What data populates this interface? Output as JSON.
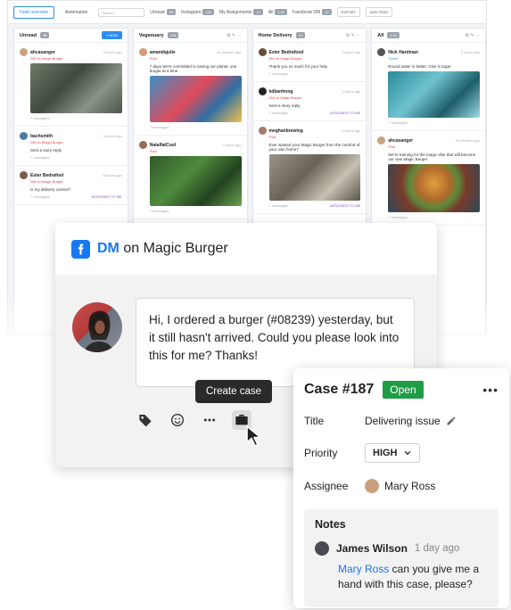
{
  "dashboard": {
    "tabs": [
      "Field overview",
      "Automation"
    ],
    "search_placeholder": "Search...",
    "filters": [
      {
        "label": "Unread",
        "count": "38"
      },
      {
        "label": "Instagram",
        "count": "125"
      },
      {
        "label": "My Assignments",
        "count": "12"
      },
      {
        "label": "All",
        "count": "1.2k"
      },
      {
        "label": "Facebook DM",
        "count": "24"
      }
    ],
    "buttons": {
      "export": "EXPORT",
      "add_feed": "ADD FEED"
    },
    "columns": [
      {
        "title": "Unread",
        "count": "38",
        "new_label": "+ NEW"
      },
      {
        "title": "Veganuary",
        "count": "125"
      },
      {
        "title": "Home Delivery",
        "count": "14"
      },
      {
        "title": "All",
        "count": "1.2k"
      }
    ],
    "cards": [
      {
        "name": "ahcasanger",
        "sub": "DM on Magic Burger",
        "time": "3 hours ago",
        "msg": "",
        "meta": "7 messages"
      },
      {
        "name": "bachsmith",
        "sub": "DM on Magic Burger",
        "time": "5 hours ago",
        "msg": "Sent a story reply",
        "meta": "7 messages"
      },
      {
        "name": "Ester Bedrafool",
        "sub": "DM on Magic Burger",
        "time": "6 hours ago",
        "msg": "Is my delivery correct?",
        "meta": "7 messages",
        "assigned": "ASSIGNED TO ME"
      },
      {
        "name": "amandajulie",
        "sub": "Post",
        "time": "16 minutes ago",
        "msg": "7 days we're committed to saving our planet, one burger at a time",
        "meta": "7 messages"
      },
      {
        "name": "NatalfatCool",
        "sub": "Post",
        "time": "3 hours ago",
        "msg": "",
        "meta": "7 messages"
      },
      {
        "name": "Ester Bedrafood",
        "sub": "DM on Magic Burger",
        "time": "2 hours ago",
        "msg": "Thank you so much for your help",
        "meta": "7 messages"
      },
      {
        "name": "kdbanhong",
        "sub": "DM on Magic Burger",
        "time": "2 hours ago",
        "msg": "Sent a story reply",
        "meta": "7 messages",
        "assigned": "ASSIGNED TO ME"
      },
      {
        "name": "meghanbrewing",
        "sub": "Post",
        "time": "4 hours ago",
        "msg": "Ever wanted your Magic Burger from the comfort of your own home?",
        "meta": "7 messages",
        "assigned": "ASSIGNED TO ME"
      },
      {
        "name": "Nick Hardman",
        "sub": "Tweet",
        "time": "2 hours ago",
        "msg": "Round water is better. Give it sugar",
        "meta": "7 messages"
      },
      {
        "name": "ahcasanger",
        "sub": "Post",
        "time": "16 minutes ago",
        "msg": "We're training for the magic vibe that will become our own Magic Burger",
        "meta": "7 messages"
      }
    ]
  },
  "dm": {
    "channel": "DM",
    "title_rest": " on Magic Burger",
    "message": "Hi, I ordered a burger (#08239) yesterday, but it still hasn't arrived. Could you please look into this for me? Thanks!",
    "tooltip": "Create case",
    "icons": [
      "tag-icon",
      "emoji-icon",
      "more-icon",
      "briefcase-icon"
    ]
  },
  "case": {
    "title": "Case #187",
    "status": "Open",
    "fields": {
      "title_label": "Title",
      "title_value": "Delivering issue",
      "priority_label": "Priority",
      "priority_value": "HIGH",
      "assignee_label": "Assignee",
      "assignee_value": "Mary Ross"
    },
    "notes": {
      "heading": "Notes",
      "author": "James Wilson",
      "time": "1 day ago",
      "mention": "Mary Ross",
      "text": " can you give me a hand with this case, please?"
    }
  },
  "colors": {
    "accent": "#1877f2",
    "open_green": "#1f9d45",
    "tooltip_bg": "#2a2a2a"
  }
}
